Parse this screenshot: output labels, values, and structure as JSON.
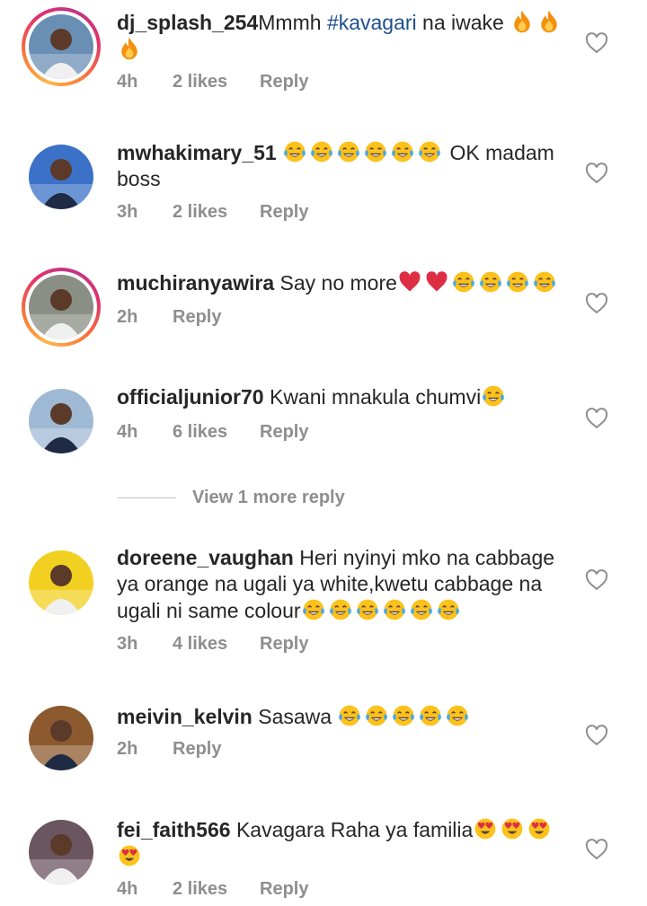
{
  "comments": [
    {
      "username": "dj_splash_254",
      "text_before": "Mmmh ",
      "hashtag": "#kavagari",
      "text_after": " na iwake ",
      "emojis": [
        "fire",
        "fire",
        "fire"
      ],
      "time": "4h",
      "likes": "2 likes",
      "reply": "Reply",
      "story_ring": true,
      "avatar_color": "#6a8fb5"
    },
    {
      "username": "mwhakimary_51",
      "text_before": " ",
      "emojis_inline": [
        "joy",
        "joy",
        "joy",
        "joy",
        "joy",
        "joy"
      ],
      "text_after": " OK madam boss",
      "time": "3h",
      "likes": "2 likes",
      "reply": "Reply",
      "story_ring": false,
      "avatar_color": "#3b72c8"
    },
    {
      "username": "muchiranyawira",
      "text_before": " Say no more",
      "emojis": [
        "heart",
        "heart",
        "joy",
        "joy",
        "joy",
        "joy"
      ],
      "time": "2h",
      "likes": "",
      "reply": "Reply",
      "story_ring": true,
      "avatar_color": "#8a8f86"
    },
    {
      "username": "officialjunior70",
      "text_before": " Kwani mnakula chumvi",
      "emojis": [
        "joy"
      ],
      "time": "4h",
      "likes": "6 likes",
      "reply": "Reply",
      "story_ring": false,
      "avatar_color": "#9fb9d4"
    },
    {
      "username": "doreene_vaughan",
      "text_before": " Heri nyinyi mko na cabbage ya orange na ugali ya white,kwetu cabbage na ugali ni same colour",
      "emojis": [
        "joy",
        "joy",
        "joy",
        "joy",
        "joy",
        "joy"
      ],
      "time": "3h",
      "likes": "4 likes",
      "reply": "Reply",
      "story_ring": false,
      "avatar_color": "#f2d021"
    },
    {
      "username": "meivin_kelvin",
      "text_before": " Sasawa ",
      "emojis": [
        "joy",
        "joy",
        "joy",
        "joy",
        "joy"
      ],
      "time": "2h",
      "likes": "",
      "reply": "Reply",
      "story_ring": false,
      "avatar_color": "#8c5a2e"
    },
    {
      "username": "fei_faith566",
      "text_before": " Kavagara Raha ya familia",
      "emojis": [
        "heart_eyes",
        "heart_eyes",
        "heart_eyes",
        "heart_eyes"
      ],
      "time": "4h",
      "likes": "2 likes",
      "reply": "Reply",
      "story_ring": false,
      "avatar_color": "#6b5560"
    }
  ],
  "view_more_label": "View 1 more reply",
  "colors": {
    "text": "#262626",
    "muted": "#8e8e8e",
    "hashtag": "#1e4f8c",
    "heart_outline": "#8e8e8e"
  },
  "icons": {
    "like": "heart-outline-icon"
  }
}
